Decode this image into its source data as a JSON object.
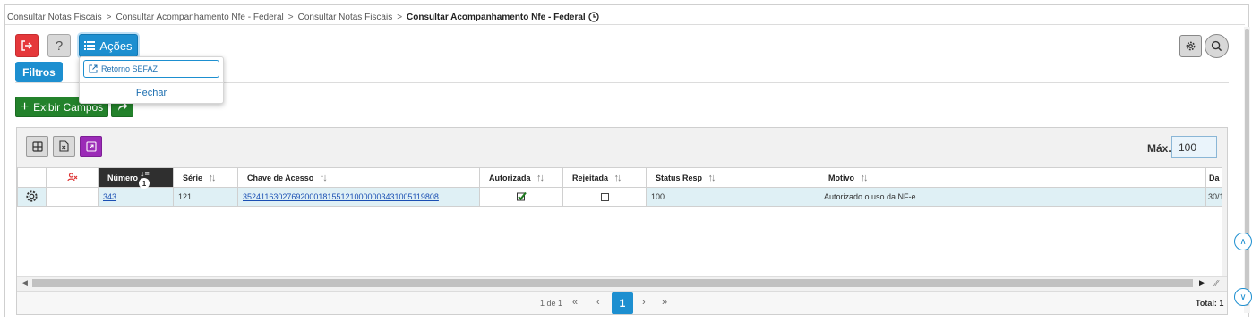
{
  "breadcrumb": {
    "items": [
      "Consultar Notas Fiscais",
      "Consultar Acompanhamento Nfe - Federal",
      "Consultar Notas Fiscais"
    ],
    "current": "Consultar Acompanhamento Nfe - Federal",
    "separator": ">"
  },
  "toolbar": {
    "help_label": "?",
    "acoes_label": "Ações",
    "filtros_label": "Filtros",
    "exibir_campos_label": "Exibir Campos"
  },
  "acoes_menu": {
    "items": [
      {
        "label": "Retorno SEFAZ"
      }
    ],
    "close_label": "Fechar"
  },
  "grid": {
    "max_label": "Máx.",
    "max_value": "100",
    "columns": {
      "numero": "Número",
      "serie": "Série",
      "chave": "Chave de Acesso",
      "autorizada": "Autorizada",
      "rejeitada": "Rejeitada",
      "status": "Status Resp",
      "motivo": "Motivo",
      "data": "Da"
    },
    "sort_badge": "1",
    "rows": [
      {
        "numero": "343",
        "serie": "121",
        "chave": "35241163027692000181551210000003431005119808",
        "autorizada": true,
        "rejeitada": false,
        "status": "100",
        "motivo": "Autorizado o uso da NF-e",
        "data": "30/1"
      }
    ]
  },
  "pager": {
    "info": "1 de 1",
    "current_page": "1",
    "total": "Total: 1"
  },
  "colors": {
    "primary": "#1d8fd0",
    "danger": "#e5383b",
    "success": "#23822b",
    "purple": "#9b2bb7",
    "row_selected": "#dff0f5"
  }
}
